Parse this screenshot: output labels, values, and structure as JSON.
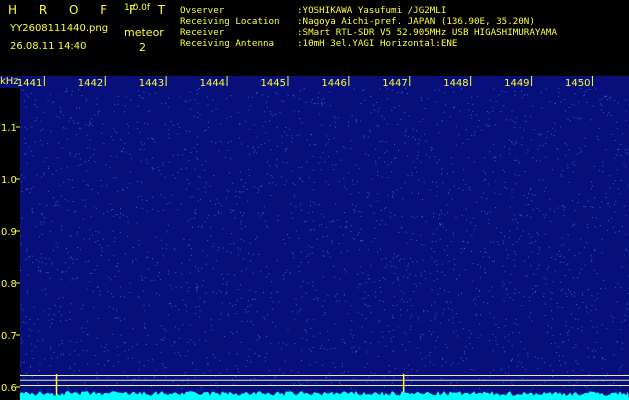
{
  "header": {
    "app_title": "H R O F F T",
    "app_version": "1.0.0f",
    "file_name": "YY2608111440.png",
    "date_time": "26.08.11 14:40",
    "meteor_label": "meteor",
    "meteor_count": "2"
  },
  "info": [
    {
      "label": "Ovserver",
      "value": ":YOSHIKAWA Yasufumi /JG2MLI"
    },
    {
      "label": "Receiving Location",
      "value": ":Nagoya Aichi-pref. JAPAN (136.90E, 35.20N)"
    },
    {
      "label": "Receiver",
      "value": ":SMart RTL-SDR V5 52.905MHz USB HIGASHIMURAYAMA"
    },
    {
      "label": "Receiving Antenna",
      "value": ":10mH 3el.YAGI Horizontal:ENE"
    }
  ],
  "chart_data": {
    "type": "heatmap",
    "ylabel": "kHz",
    "x_ticks": [
      "1441",
      "1442",
      "1443",
      "1444",
      "1445",
      "1446",
      "1447",
      "1448",
      "1449",
      "1450"
    ],
    "x_range": [
      1440.6,
      1450.6
    ],
    "y_ticks": [
      1.1,
      1.0,
      0.9,
      0.8,
      0.7,
      0.6
    ],
    "y_range": [
      0.575,
      1.175
    ],
    "background_color": "#07107a",
    "noise_color": "#4a6cff",
    "baseline_color": "#00ffff",
    "marker_color": "#ffff33",
    "reference_lines_khz": [
      0.622,
      0.613,
      0.603
    ],
    "meteor_marks_x": [
      1441.2,
      1446.9
    ]
  }
}
